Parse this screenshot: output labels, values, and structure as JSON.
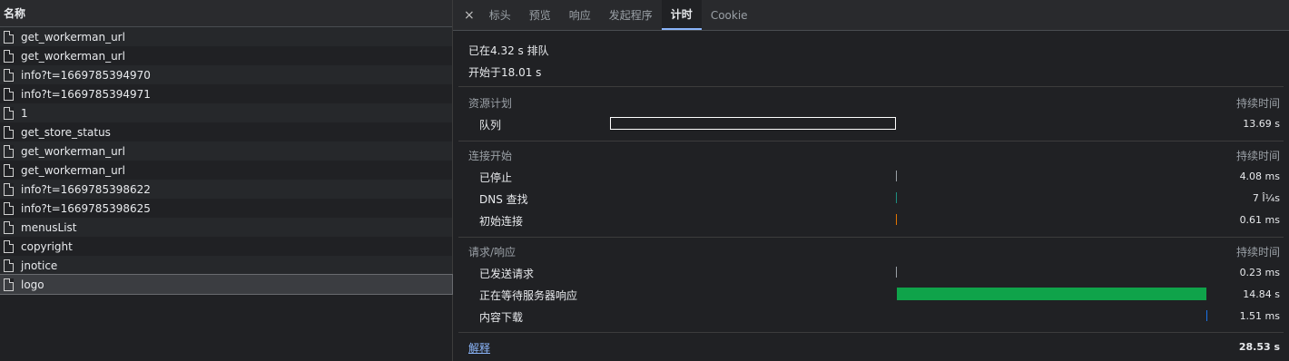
{
  "left": {
    "header": "名称",
    "rows": [
      {
        "name": "get_workerman_url"
      },
      {
        "name": "get_workerman_url"
      },
      {
        "name": "info?t=1669785394970"
      },
      {
        "name": "info?t=1669785394971"
      },
      {
        "name": "1"
      },
      {
        "name": "get_store_status"
      },
      {
        "name": "get_workerman_url"
      },
      {
        "name": "get_workerman_url"
      },
      {
        "name": "info?t=1669785398622"
      },
      {
        "name": "info?t=1669785398625"
      },
      {
        "name": "menusList"
      },
      {
        "name": "copyright"
      },
      {
        "name": "jnotice"
      },
      {
        "name": "logo"
      }
    ],
    "selected_index": 13
  },
  "tabs": {
    "close": "×",
    "items": [
      "标头",
      "预览",
      "响应",
      "发起程序",
      "计时",
      "Cookie"
    ],
    "active": "计时"
  },
  "timing": {
    "queued": "已在4.32 s 排队",
    "started": "开始于18.01 s",
    "duration_header": "持续时间",
    "sections": [
      {
        "title": "资源计划",
        "rows": [
          {
            "label": "队列",
            "duration": "13.69 s",
            "color": "#ffffff",
            "style": "outline"
          }
        ]
      },
      {
        "title": "连接开始",
        "rows": [
          {
            "label": "已停止",
            "duration": "4.08 ms",
            "color": "#9aa0a6"
          },
          {
            "label": "DNS 查找",
            "duration": "7 Î¼s",
            "color": "#1e8e80"
          },
          {
            "label": "初始连接",
            "duration": "0.61 ms",
            "color": "#e37400"
          }
        ]
      },
      {
        "title": "请求/响应",
        "rows": [
          {
            "label": "已发送请求",
            "duration": "0.23 ms",
            "color": "#9aa0a6"
          },
          {
            "label": "正在等待服务器响应",
            "duration": "14.84 s",
            "color": "#0fa34a"
          },
          {
            "label": "内容下载",
            "duration": "1.51 ms",
            "color": "#1a73e8"
          }
        ]
      }
    ],
    "explain": "解释",
    "total": "28.53 s"
  }
}
